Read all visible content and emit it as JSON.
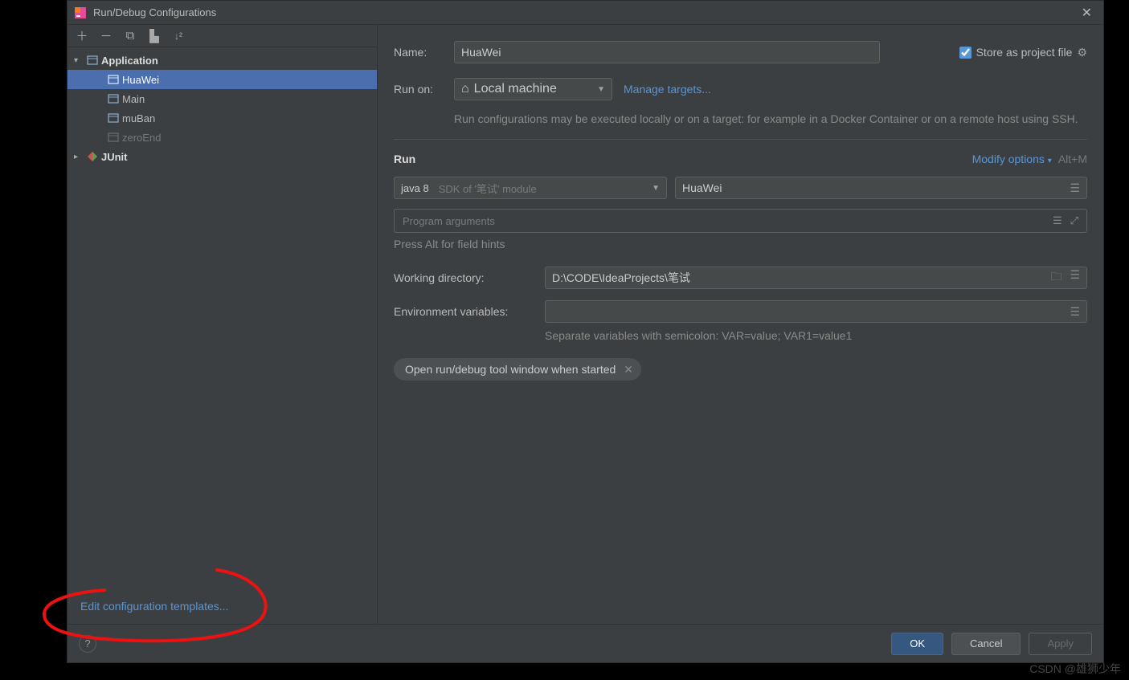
{
  "window": {
    "title": "Run/Debug Configurations"
  },
  "tree": {
    "application": "Application",
    "items": [
      "HuaWei",
      "Main",
      "muBan",
      "zeroEnd"
    ],
    "junit": "JUnit"
  },
  "sidebar": {
    "edit_templates": "Edit configuration templates..."
  },
  "form": {
    "name_label": "Name:",
    "name_value": "HuaWei",
    "store_label": "Store as project file",
    "runon_label": "Run on:",
    "runon_value": "Local machine",
    "manage_targets": "Manage targets...",
    "runon_desc": "Run configurations may be executed locally or on a target: for example in a Docker Container or on a remote host using SSH.",
    "section": "Run",
    "modify_options": "Modify options",
    "modify_shortcut": "Alt+M",
    "jdk_prefix": "java 8",
    "jdk_hint": "SDK of '笔试' module",
    "main_class": "HuaWei",
    "args_placeholder": "Program arguments",
    "hints": "Press Alt for field hints",
    "workdir_label": "Working directory:",
    "workdir_value": "D:\\CODE\\IdeaProjects\\笔试",
    "env_label": "Environment variables:",
    "env_value": "",
    "env_hint": "Separate variables with semicolon: VAR=value; VAR1=value1",
    "chip": "Open run/debug tool window when started"
  },
  "footer": {
    "ok": "OK",
    "cancel": "Cancel",
    "apply": "Apply"
  },
  "watermark": "CSDN @雄狮少年"
}
